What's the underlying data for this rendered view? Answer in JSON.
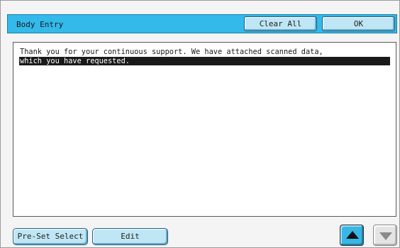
{
  "header": {
    "title": "Body Entry",
    "clear_all_label": "Clear All",
    "ok_label": "OK"
  },
  "body_text": {
    "line1": "Thank you for your continuous support. We have attached scanned data,",
    "line2": "which you have requested."
  },
  "footer": {
    "preset_label": "Pre-Set Select",
    "edit_label": "Edit",
    "scroll_up": "arrow-up-icon",
    "scroll_down": "arrow-down-icon"
  },
  "colors": {
    "header_bg": "#33b9ea",
    "button_bg": "#bfe6f5",
    "highlight": "#1a1a1a"
  }
}
